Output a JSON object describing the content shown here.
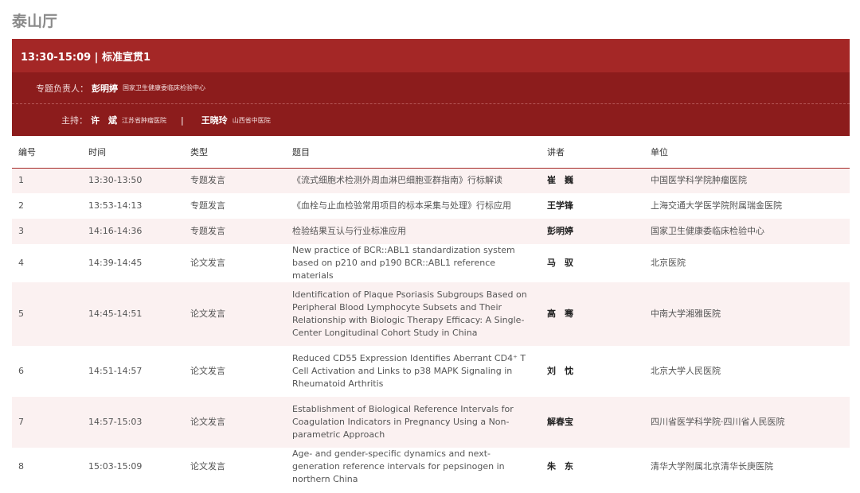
{
  "hall": {
    "title": "泰山厅"
  },
  "session": {
    "header": "13:30-15:09 | 标准宣贯1",
    "lead": {
      "label": "专题负责人：",
      "name": "彭明婷",
      "org": "国家卫生健康委临床检验中心"
    },
    "chairs": {
      "label": "主持：",
      "items": [
        {
          "name": "许　斌",
          "org": "江苏省肿瘤医院"
        },
        {
          "name": "王晓玲",
          "org": "山西省中医院"
        }
      ],
      "separator": "|"
    }
  },
  "table": {
    "headers": [
      "编号",
      "时间",
      "类型",
      "题目",
      "讲者",
      "单位"
    ],
    "rows": [
      {
        "no": "1",
        "time": "13:30-13:50",
        "type": "专题发言",
        "title": "《流式细胞术检测外周血淋巴细胞亚群指南》行标解读",
        "speaker": "崔　巍",
        "unit": "中国医学科学院肿瘤医院"
      },
      {
        "no": "2",
        "time": "13:53-14:13",
        "type": "专题发言",
        "title": "《血栓与止血检验常用项目的标本采集与处理》行标应用",
        "speaker": "王学锋",
        "unit": "上海交通大学医学院附属瑞金医院"
      },
      {
        "no": "3",
        "time": "14:16-14:36",
        "type": "专题发言",
        "title": "检验结果互认与行业标准应用",
        "speaker": "彭明婷",
        "unit": "国家卫生健康委临床检验中心"
      },
      {
        "no": "4",
        "time": "14:39-14:45",
        "type": "论文发言",
        "title": "New practice of BCR::ABL1 standardization system based on p210 and p190 BCR::ABL1 reference materials",
        "speaker": "马　驭",
        "unit": "北京医院"
      },
      {
        "no": "5",
        "time": "14:45-14:51",
        "type": "论文发言",
        "title": "Identification of Plaque Psoriasis Subgroups Based on Peripheral Blood Lymphocyte Subsets and Their Relationship with Biologic Therapy Efficacy: A Single-Center Longitudinal Cohort Study in China",
        "speaker": "高　骞",
        "unit": "中南大学湘雅医院"
      },
      {
        "no": "6",
        "time": "14:51-14:57",
        "type": "论文发言",
        "title": "Reduced CD55 Expression Identifies Aberrant CD4⁺ T Cell Activation and Links to p38 MAPK Signaling in Rheumatoid Arthritis",
        "speaker": "刘　忱",
        "unit": "北京大学人民医院"
      },
      {
        "no": "7",
        "time": "14:57-15:03",
        "type": "论文发言",
        "title": "Establishment of Biological Reference Intervals for Coagulation Indicators in Pregnancy Using a Non-parametric Approach",
        "speaker": "解春宝",
        "unit": "四川省医学科学院·四川省人民医院"
      },
      {
        "no": "8",
        "time": "15:03-15:09",
        "type": "论文发言",
        "title": "Age- and gender-specific dynamics and next-generation reference intervals for pepsinogen in northern China",
        "speaker": "朱　东",
        "unit": "清华大学附属北京清华长庚医院"
      }
    ]
  }
}
